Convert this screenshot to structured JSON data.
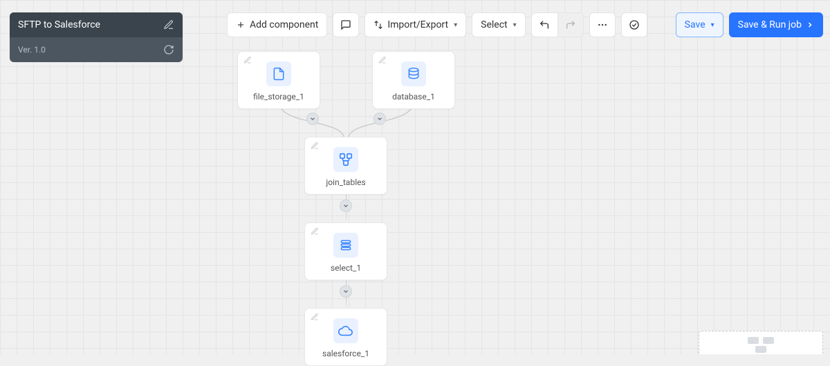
{
  "panel": {
    "title": "SFTP to Salesforce",
    "version": "Ver. 1.0"
  },
  "toolbar": {
    "add_component": "Add component",
    "import_export": "Import/Export",
    "select": "Select",
    "save": "Save",
    "save_run": "Save & Run job"
  },
  "nodes": {
    "file_storage": "file_storage_1",
    "database": "database_1",
    "join_tables": "join_tables",
    "select": "select_1",
    "salesforce": "salesforce_1"
  }
}
